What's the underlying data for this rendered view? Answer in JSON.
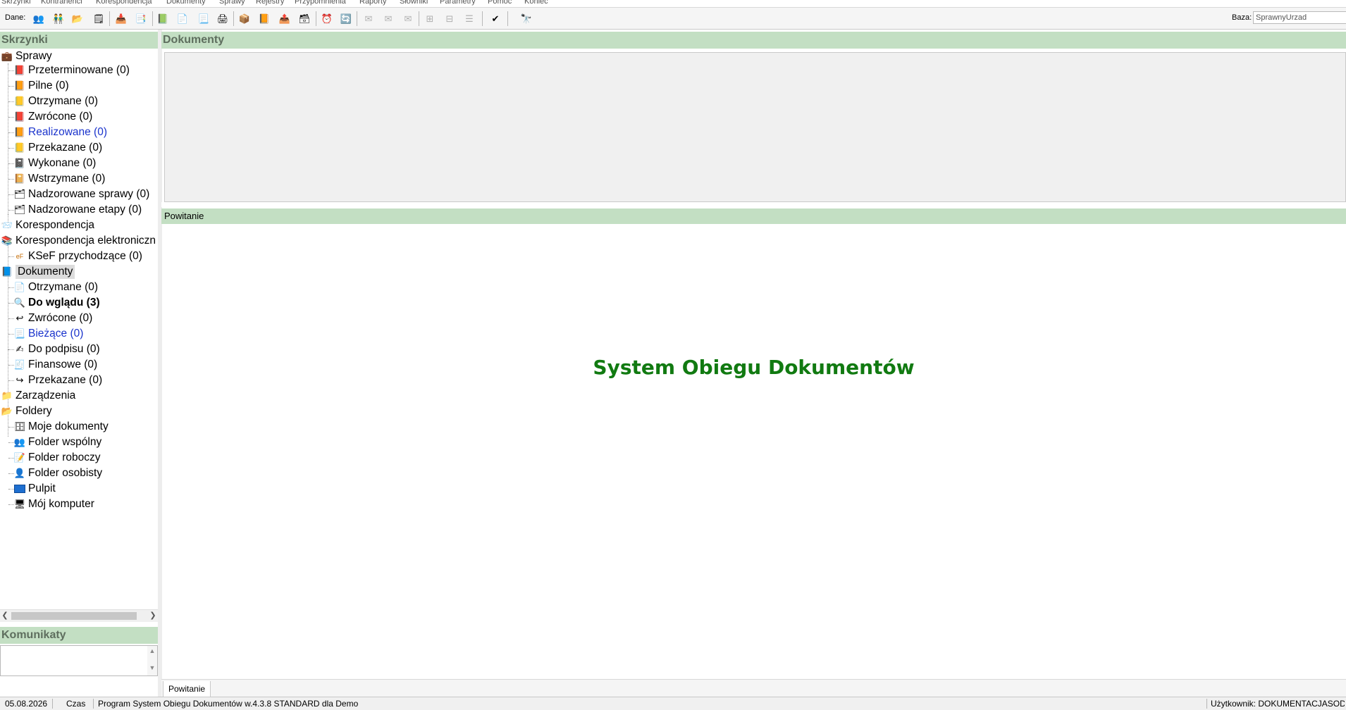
{
  "menu": {
    "items": [
      "Skrzynki",
      "Kontrahenci",
      "Korespondencja",
      "Dokumenty",
      "Sprawy",
      "Rejestry",
      "Przypomnienia",
      "Raporty",
      "Słowniki",
      "Parametry",
      "Pomoc",
      "Koniec"
    ]
  },
  "toolbar": {
    "dane_label": "Dane:",
    "baza_label": "Baza:",
    "baza_value": "SprawnyUrzad"
  },
  "left": {
    "skrzynki_title": "Skrzynki",
    "komunikaty_title": "Komunikaty",
    "tree": {
      "sprawy": "Sprawy",
      "sprawy_children": [
        "Przeterminowane (0)",
        "Pilne (0)",
        "Otrzymane (0)",
        "Zwrócone (0)",
        "Realizowane (0)",
        "Przekazane (0)",
        "Wykonane (0)",
        "Wstrzymane (0)",
        "Nadzorowane sprawy (0)",
        "Nadzorowane etapy (0)"
      ],
      "korespondencja": "Korespondencja",
      "korespondencja_el": "Korespondencja elektroniczn",
      "ksef": "KSeF przychodzące (0)",
      "dokumenty": "Dokumenty",
      "dokumenty_children": [
        "Otrzymane (0)",
        "Do wglądu (3)",
        "Zwrócone (0)",
        "Bieżące (0)",
        "Do podpisu (0)",
        "Finansowe (0)",
        "Przekazane (0)"
      ],
      "zarzadzenia": "Zarządzenia",
      "foldery": "Foldery",
      "foldery_children": [
        "Moje dokumenty",
        "Folder wspólny",
        "Folder roboczy",
        "Folder osobisty",
        "Pulpit",
        "Mój komputer"
      ]
    }
  },
  "main": {
    "dokumenty_title": "Dokumenty",
    "powitanie_bar": "Powitanie",
    "welcome_title": "System Obiegu Dokumentów",
    "tab_label": "Powitanie"
  },
  "status": {
    "date": "05.08.2026",
    "czas": "Czas",
    "program": "Program System Obiegu Dokumentów w.4.3.8 STANDARD dla Demo",
    "user": "Użytkownik: DOKUMENTACJASOD [I"
  },
  "icons": {
    "toolbar": [
      "contacts-icon",
      "users-icon",
      "open-folder-icon",
      "list-icon",
      "add-doc-icon",
      "copy-doc-icon",
      "green-doc-icon",
      "doc-icon",
      "doc-arrow-icon",
      "doc-print-icon",
      "case-up-icon",
      "case-book-icon",
      "case-forward-icon",
      "case-grid-icon",
      "clock-icon",
      "refresh-icon",
      "mail-icon",
      "mail-open-icon",
      "mail-send-icon",
      "tree-expand-icon",
      "tree-collapse-icon",
      "tree-list-icon",
      "check-icon",
      "search-binoculars-icon"
    ]
  }
}
